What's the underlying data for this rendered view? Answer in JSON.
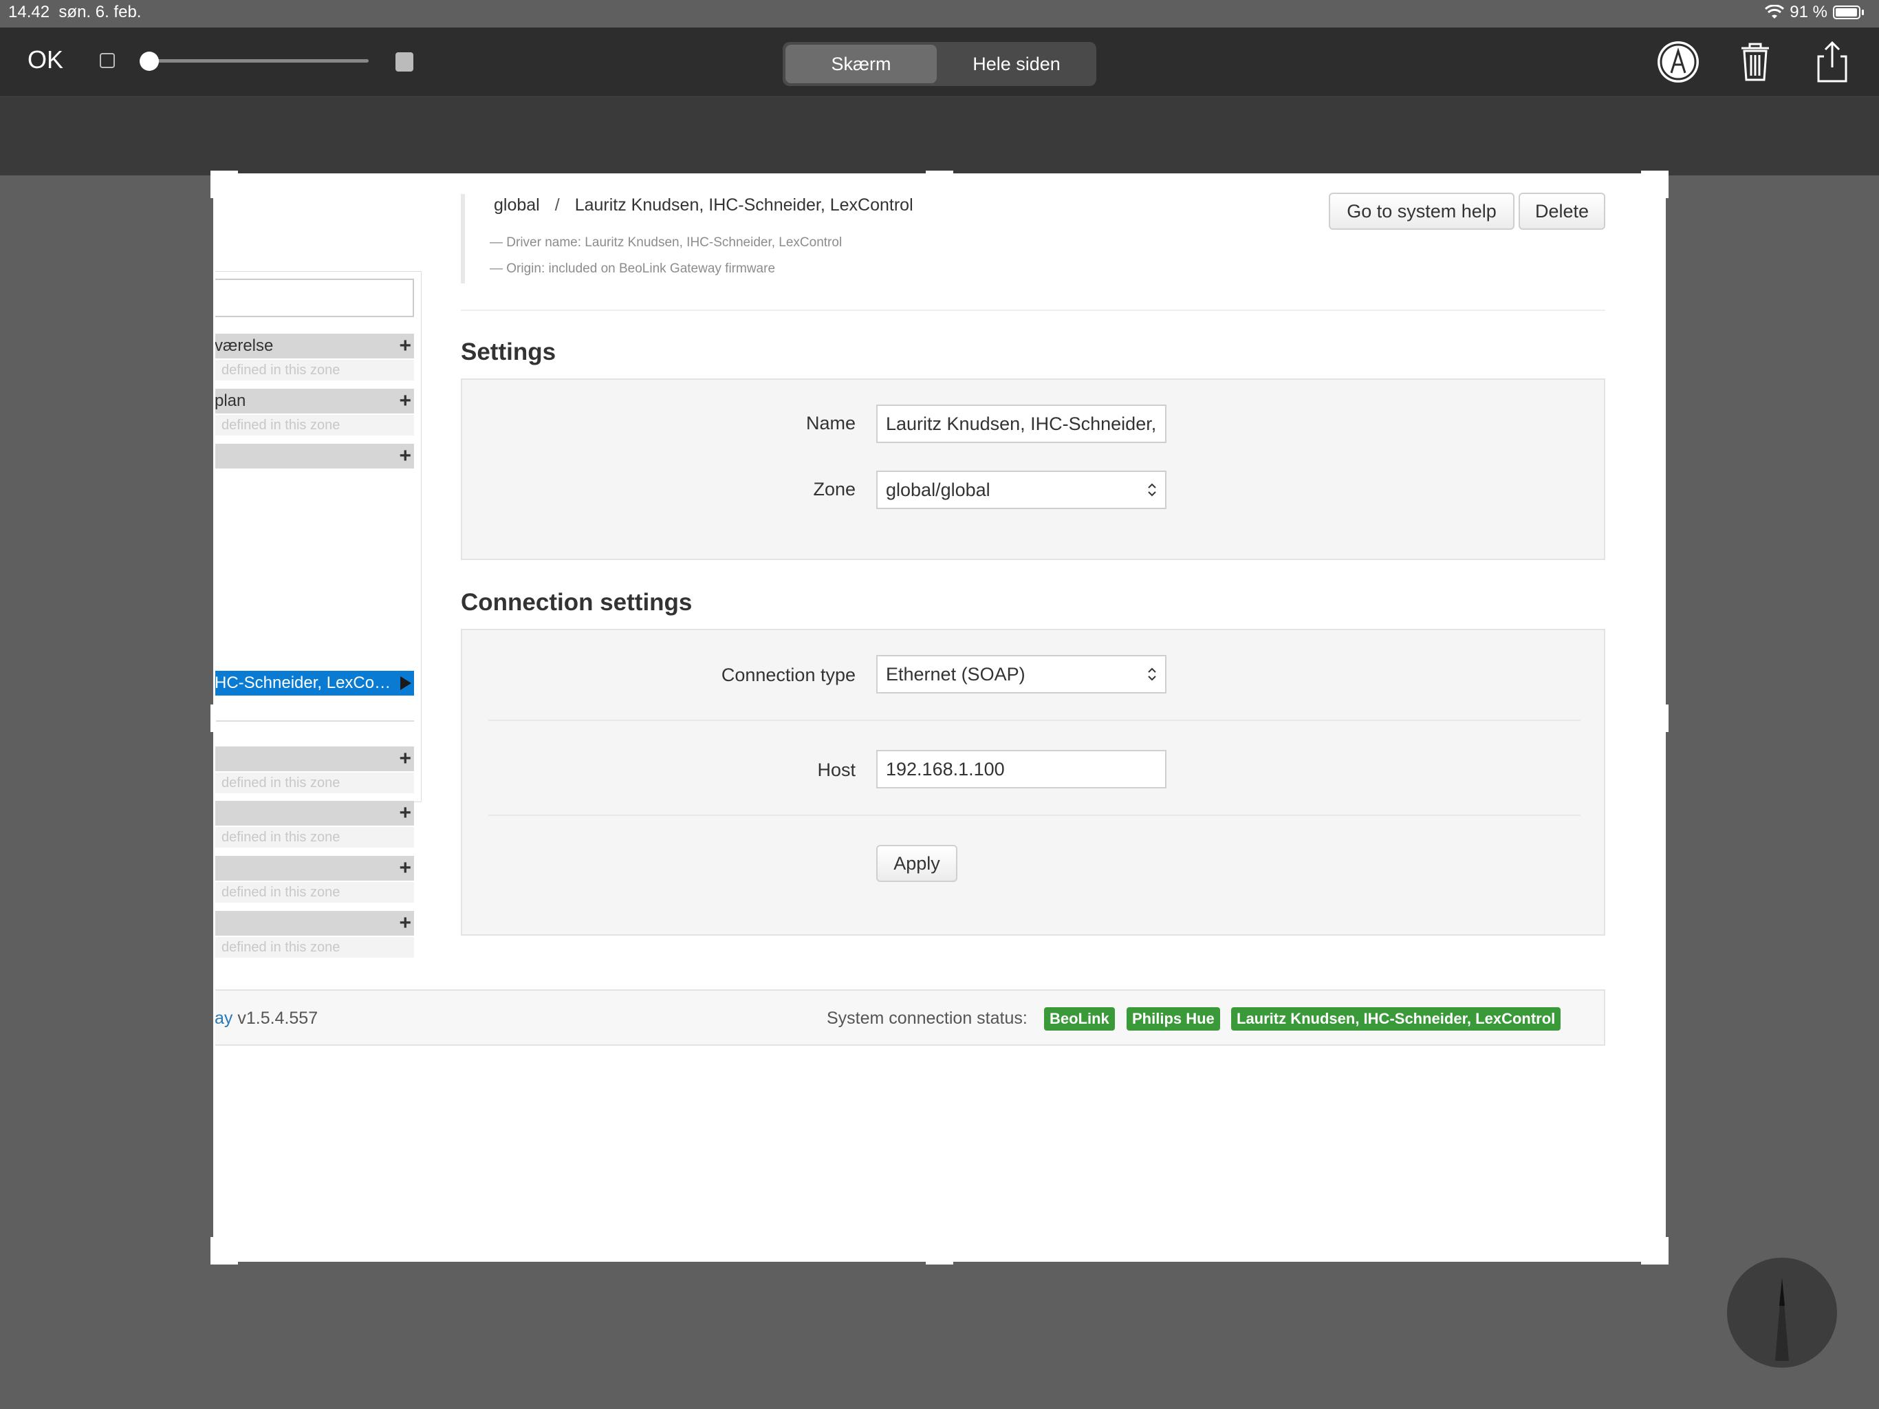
{
  "status_bar": {
    "time": "14.42",
    "date": "søn. 6. feb.",
    "battery": "91 %",
    "battery_level": 0.91
  },
  "toolbar": {
    "ok_label": "OK",
    "segments": [
      "Skærm",
      "Hele siden"
    ],
    "selected_segment": "Skærm",
    "icons": [
      "square-icon",
      "opacity-slider",
      "filled-square-icon",
      "markup-pen-icon",
      "trash-icon",
      "share-icon"
    ]
  },
  "sidebar": {
    "items": [
      {
        "label": "værelse",
        "sub": "defined in this zone"
      },
      {
        "label": "plan",
        "sub": "defined in this zone"
      },
      {
        "label": "",
        "sub": ""
      },
      {
        "label": "HC-Schneider, LexCo…",
        "selected": true
      },
      {
        "label": "",
        "sub": "defined in this zone"
      },
      {
        "label": "",
        "sub": "defined in this zone"
      },
      {
        "label": "",
        "sub": "defined in this zone"
      },
      {
        "label": "",
        "sub": "defined in this zone"
      }
    ]
  },
  "header": {
    "breadcrumb": [
      "global",
      "Lauritz Knudsen, IHC-Schneider, LexControl"
    ],
    "breadcrumb_sep": "/",
    "driver_name": "— Driver name: Lauritz Knudsen, IHC-Schneider, LexControl",
    "origin": "— Origin: included on BeoLink Gateway firmware",
    "help_button": "Go to system help",
    "delete_button": "Delete"
  },
  "settings": {
    "title": "Settings",
    "name_label": "Name",
    "name_value": "Lauritz Knudsen, IHC-Schneider,",
    "zone_label": "Zone",
    "zone_value": "global/global"
  },
  "connection": {
    "title": "Connection settings",
    "type_label": "Connection type",
    "type_value": "Ethernet (SOAP)",
    "host_label": "Host",
    "host_value": "192.168.1.100",
    "apply_button": "Apply"
  },
  "footer": {
    "version_prefix": "ay",
    "version": "v1.5.4.557",
    "status_label": "System connection status:",
    "badges": [
      "BeoLink",
      "Philips Hue",
      "Lauritz Knudsen, IHC-Schneider, LexControl"
    ],
    "badge_color": "#3a9a3a"
  }
}
